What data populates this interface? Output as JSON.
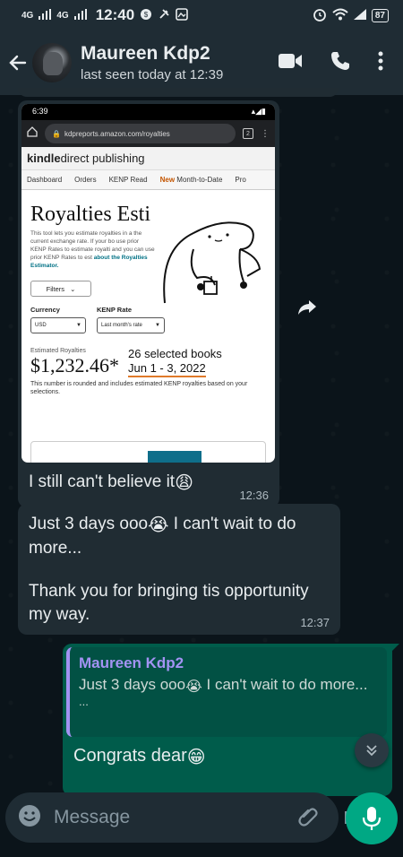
{
  "status_bar": {
    "signal1": "4G",
    "signal2": "4G",
    "time": "12:40",
    "battery": "87"
  },
  "header": {
    "contact_name": "Maureen Kdp2",
    "last_seen": "last seen today at 12:39"
  },
  "image_message": {
    "screenshot": {
      "status_time": "6:39",
      "url": "kdpreports.amazon.com/royalties",
      "tab_count": "2",
      "brand_prefix": "kindle",
      "brand_suffix": " direct publishing",
      "nav": [
        "Dashboard",
        "Orders",
        "KENP Read",
        "New",
        "Month-to-Date",
        "Pro"
      ],
      "title": "Royalties Esti",
      "description": "This tool lets you estimate royalties in a the current exchange rate. If your bo use prior KENP Rates to estimate royalti and you can use prior KENP Rates to est",
      "description_link": "about the Royalties Estimator.",
      "filters_label": "Filters",
      "currency_label": "Currency",
      "currency_value": "USD",
      "kenp_label": "KENP Rate",
      "kenp_value": "Last month's rate",
      "estimated_label": "Estimated Royalties",
      "amount": "$1,232.46*",
      "books": "26 selected books",
      "date_range": "Jun 1 - 3, 2022",
      "note": "This number is rounded and includes estimated KENP royalties based on your selections."
    },
    "caption": "I still can't believe it",
    "caption_emoji": "😩",
    "time": "12:36"
  },
  "message2": {
    "line1": "Just 3 days ooo",
    "line1_emoji": "😭",
    "line1_rest": " I can't wait to do more...",
    "line2": "Thank you for bringing tis opportunity my way.",
    "time": "12:37"
  },
  "reply_message": {
    "quoted_name": "Maureen Kdp2",
    "quoted_text": "Just 3 days ooo",
    "quoted_emoji": "😭",
    "quoted_rest": " I can't wait to do more...",
    "quoted_ellipsis": "...",
    "text": "Congrats dear",
    "text_emoji": "😁"
  },
  "composer": {
    "placeholder": "Message"
  }
}
